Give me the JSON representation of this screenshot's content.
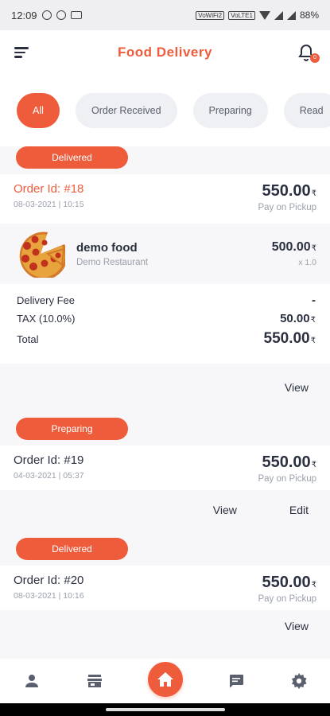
{
  "status_bar": {
    "time": "12:09",
    "net_tag_1": "VoWiFi2",
    "net_tag_2": "VoLTE1",
    "battery": "88%"
  },
  "header": {
    "title": "Food Delivery",
    "notification_count": "0"
  },
  "tabs": [
    {
      "label": "All",
      "active": true
    },
    {
      "label": "Order Received",
      "active": false
    },
    {
      "label": "Preparing",
      "active": false
    },
    {
      "label": "Read",
      "active": false
    }
  ],
  "orders": [
    {
      "status": "Delivered",
      "order_id": "Order Id: #18",
      "date": "08-03-2021 | 10:15",
      "amount": "550.00",
      "payment": "Pay on Pickup",
      "item": {
        "name": "demo food",
        "restaurant": "Demo Restaurant",
        "price": "500.00",
        "qty": "x 1.0"
      },
      "fees": {
        "delivery_label": "Delivery Fee",
        "delivery_value": "-",
        "tax_label": "TAX (10.0%)",
        "tax_value": "50.00",
        "total_label": "Total",
        "total_value": "550.00"
      },
      "view_label": "View"
    },
    {
      "status": "Preparing",
      "order_id": "Order Id: #19",
      "date": "04-03-2021 | 05:37",
      "amount": "550.00",
      "payment": "Pay on Pickup",
      "view_label": "View",
      "edit_label": "Edit"
    },
    {
      "status": "Delivered",
      "order_id": "Order Id: #20",
      "date": "08-03-2021 | 10:16",
      "amount": "550.00",
      "payment": "Pay on Pickup",
      "view_label": "View"
    }
  ],
  "currency_symbol": "₹",
  "colors": {
    "accent": "#ee5c3c",
    "text": "#2b3040",
    "muted": "#9aa0ab"
  },
  "bottom_nav": [
    "profile-icon",
    "store-icon",
    "home-icon",
    "chat-icon",
    "settings-icon"
  ]
}
